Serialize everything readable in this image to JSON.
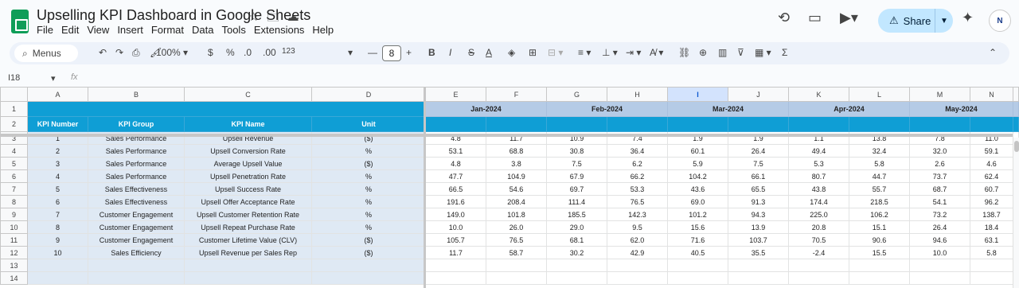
{
  "doc": {
    "title": "Upselling KPI Dashboard in Google Sheets",
    "menu": [
      "File",
      "Edit",
      "View",
      "Insert",
      "Format",
      "Data",
      "Tools",
      "Extensions",
      "Help"
    ],
    "share_label": "Share",
    "avatar_text": "N"
  },
  "toolbar": {
    "menus_label": "Menus",
    "zoom": "100%",
    "currency": "$",
    "percent": "%",
    "dec_decrease": ".0",
    "dec_increase": ".00",
    "number_format": "123",
    "font_size": "8",
    "bold": "B",
    "italic": "I",
    "strike": "S",
    "text_color": "A"
  },
  "formula_bar": {
    "name_box": "I18",
    "fx": "fx"
  },
  "sheet": {
    "columns": [
      "A",
      "B",
      "C",
      "D",
      "E",
      "F",
      "G",
      "H",
      "I",
      "J",
      "K",
      "L",
      "M",
      "N"
    ],
    "selected_column": "I",
    "months": [
      "Jan-2024",
      "Feb-2024",
      "Mar-2024",
      "Apr-2024",
      "May-2024"
    ],
    "headers": [
      "KPI Number",
      "KPI Group",
      "KPI Name",
      "Unit"
    ],
    "rows": [
      {
        "n": "1",
        "group": "Sales Performance",
        "name": "Upsell Revenue",
        "unit": "($)",
        "v": [
          "4.8",
          "11.7",
          "10.9",
          "7.4",
          "1.9",
          "1.9",
          "1.1",
          "13.8",
          "7.8",
          "11.0"
        ]
      },
      {
        "n": "2",
        "group": "Sales Performance",
        "name": "Upsell Conversion Rate",
        "unit": "%",
        "v": [
          "53.1",
          "68.8",
          "30.8",
          "36.4",
          "60.1",
          "26.4",
          "49.4",
          "32.4",
          "32.0",
          "59.1"
        ]
      },
      {
        "n": "3",
        "group": "Sales Performance",
        "name": "Average Upsell Value",
        "unit": "($)",
        "v": [
          "4.8",
          "3.8",
          "7.5",
          "6.2",
          "5.9",
          "7.5",
          "5.3",
          "5.8",
          "2.6",
          "4.6"
        ]
      },
      {
        "n": "4",
        "group": "Sales Performance",
        "name": "Upsell Penetration Rate",
        "unit": "%",
        "v": [
          "47.7",
          "104.9",
          "67.9",
          "66.2",
          "104.2",
          "66.1",
          "80.7",
          "44.7",
          "73.7",
          "62.4"
        ]
      },
      {
        "n": "5",
        "group": "Sales Effectiveness",
        "name": "Upsell Success Rate",
        "unit": "%",
        "v": [
          "66.5",
          "54.6",
          "69.7",
          "53.3",
          "43.6",
          "65.5",
          "43.8",
          "55.7",
          "68.7",
          "60.7"
        ]
      },
      {
        "n": "6",
        "group": "Sales Effectiveness",
        "name": "Upsell Offer Acceptance Rate",
        "unit": "%",
        "v": [
          "191.6",
          "208.4",
          "111.4",
          "76.5",
          "69.0",
          "91.3",
          "174.4",
          "218.5",
          "54.1",
          "96.2"
        ]
      },
      {
        "n": "7",
        "group": "Customer Engagement",
        "name": "Upsell Customer Retention Rate",
        "unit": "%",
        "v": [
          "149.0",
          "101.8",
          "185.5",
          "142.3",
          "101.2",
          "94.3",
          "225.0",
          "106.2",
          "73.2",
          "138.7"
        ]
      },
      {
        "n": "8",
        "group": "Customer Engagement",
        "name": "Upsell Repeat Purchase Rate",
        "unit": "%",
        "v": [
          "10.0",
          "26.0",
          "29.0",
          "9.5",
          "15.6",
          "13.9",
          "20.8",
          "15.1",
          "26.4",
          "18.4"
        ]
      },
      {
        "n": "9",
        "group": "Customer Engagement",
        "name": "Customer Lifetime Value (CLV)",
        "unit": "($)",
        "v": [
          "105.7",
          "76.5",
          "68.1",
          "62.0",
          "71.6",
          "103.7",
          "70.5",
          "90.6",
          "94.6",
          "63.1"
        ]
      },
      {
        "n": "10",
        "group": "Sales Efficiency",
        "name": "Upsell Revenue per Sales Rep",
        "unit": "($)",
        "v": [
          "11.7",
          "58.7",
          "30.2",
          "42.9",
          "40.5",
          "35.5",
          "-2.4",
          "15.5",
          "10.0",
          "5.8"
        ]
      }
    ]
  }
}
